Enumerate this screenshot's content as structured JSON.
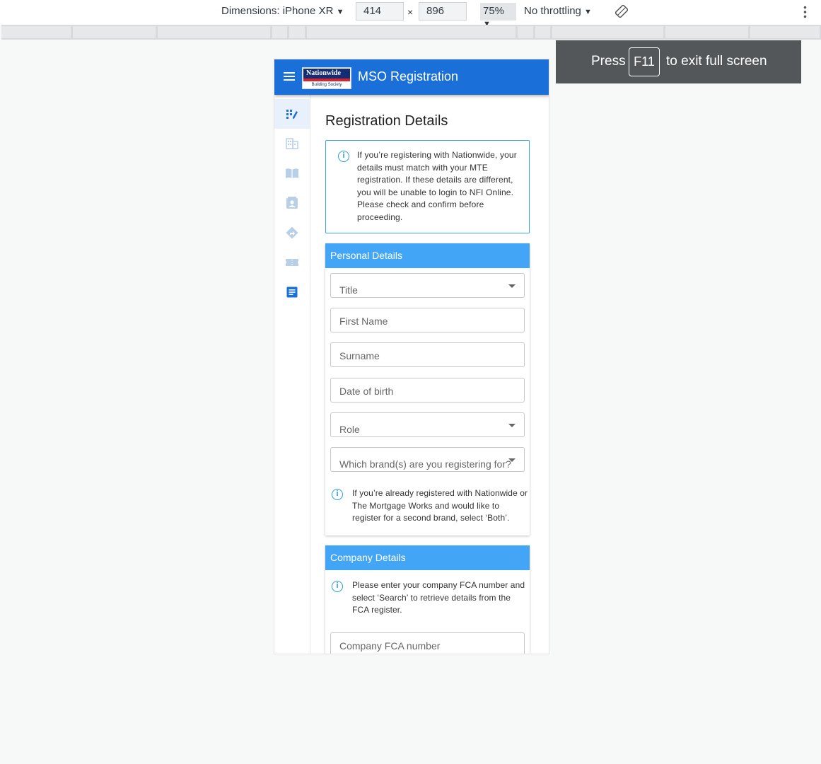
{
  "devtools": {
    "dimensions_label": "Dimensions: iPhone XR",
    "width_value": "414",
    "times_sign": "×",
    "height_value": "896",
    "zoom": "75%",
    "throttling": "No throttling",
    "caret": "▼",
    "rotate_icon": "rotate-icon",
    "more_icon": "more-vertical-icon"
  },
  "fullscreen_notice": {
    "before": "Press",
    "key": "F11",
    "after": "to exit full screen"
  },
  "app": {
    "title": "MSO Registration",
    "logo_name": "Nationwide",
    "logo_sub": "Building Society",
    "brand_color": "#1a6fd8"
  },
  "rail": {
    "items": [
      {
        "icon": "registration-edit-icon",
        "active": true
      },
      {
        "icon": "company-building-icon",
        "active": false
      },
      {
        "icon": "book-icon",
        "active": false
      },
      {
        "icon": "contact-card-icon",
        "active": false
      },
      {
        "icon": "directions-icon",
        "active": false
      },
      {
        "icon": "ticket-icon",
        "active": false
      },
      {
        "icon": "document-icon",
        "active": false
      }
    ]
  },
  "main": {
    "heading": "Registration Details",
    "info": "If you’re registering with Nationwide, your details must match with your MTE registration. If these details are different, you will be unable to login to NFI Online. Please check and confirm before proceeding.",
    "personal": {
      "header": "Personal Details",
      "fields": {
        "title": "Title",
        "first_name": "First Name",
        "surname": "Surname",
        "dob": "Date of birth",
        "role": "Role",
        "brand": "Which brand(s) are you registering for?"
      },
      "note": "If you’re already registered with Nationwide or The Mortgage Works and would like to register for a second brand, select ‘Both’."
    },
    "company": {
      "header": "Company Details",
      "note": "Please enter your company FCA number and select ‘Search’ to retrieve details from the FCA register.",
      "fca_field": "Company FCA number"
    },
    "info_icon_glyph": "i",
    "accent_color": "#42a5f5"
  }
}
